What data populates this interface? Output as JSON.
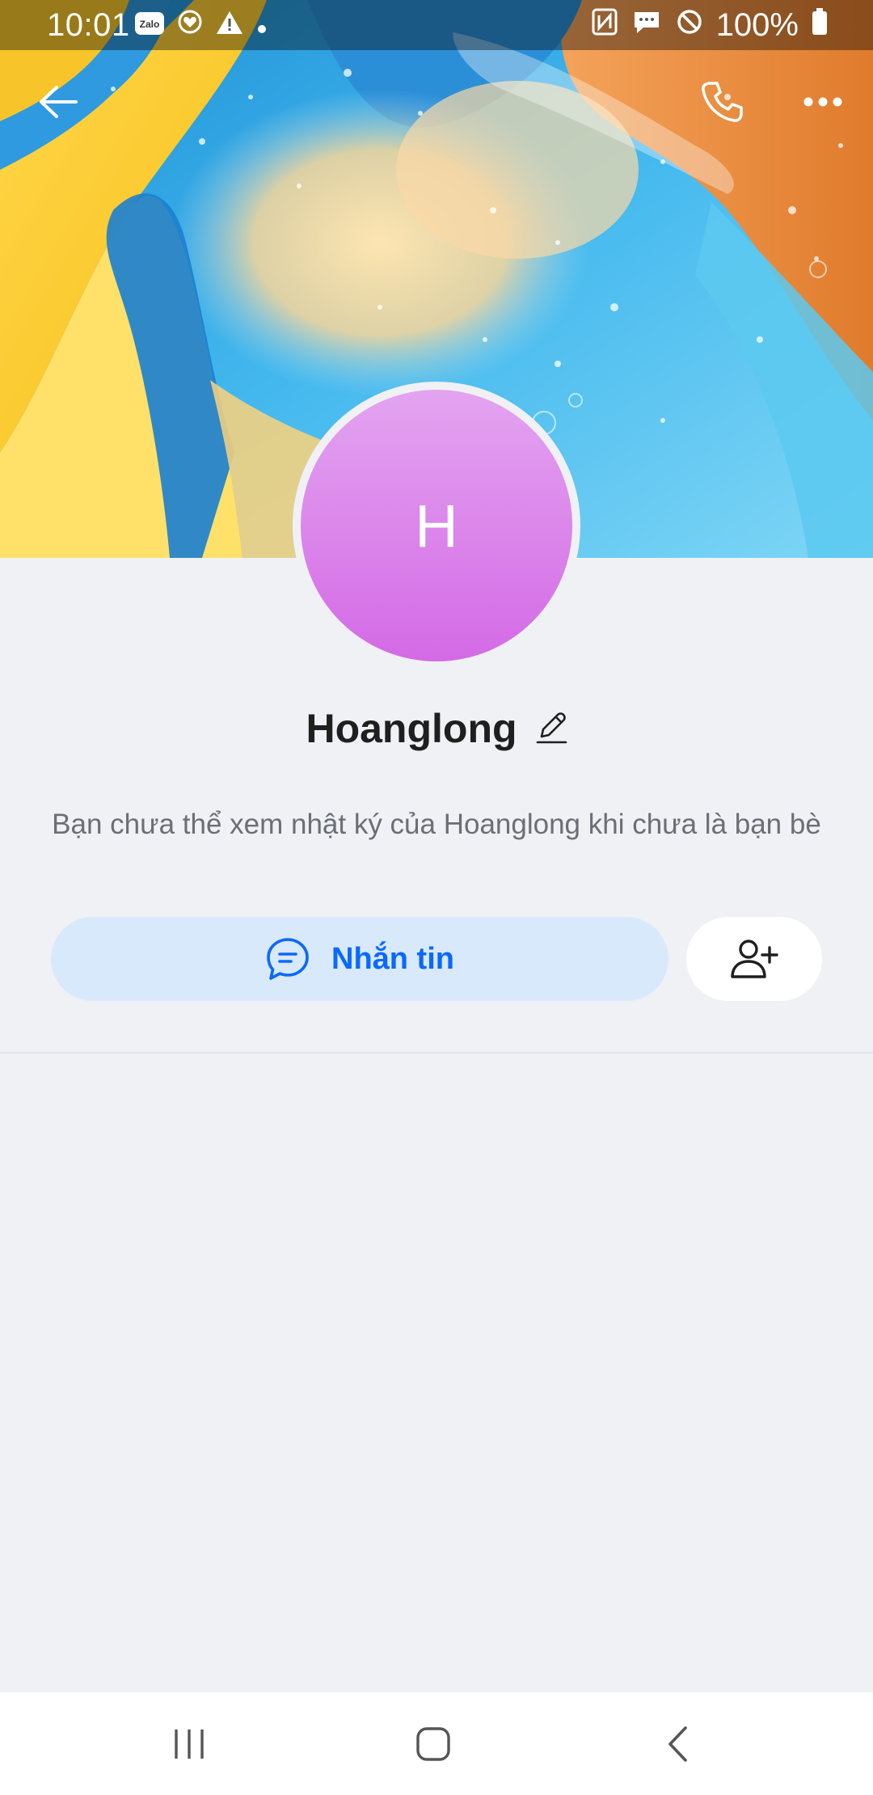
{
  "status_bar": {
    "time": "10:01",
    "battery": "100%",
    "left_icons": [
      "zalo-icon",
      "heart-sync-icon",
      "warning-icon",
      "dot-icon"
    ],
    "right_icons": [
      "nfc-icon",
      "message-icon",
      "do-not-disturb-icon",
      "battery-icon"
    ]
  },
  "top_bar": {
    "icons": [
      "back-arrow-icon",
      "phone-icon",
      "more-icon"
    ]
  },
  "profile": {
    "avatar_initial": "H",
    "name": "Hoanglong",
    "avatar_gradient": [
      "#e3a4f0",
      "#d46ae6"
    ],
    "notice": "Bạn chưa thể xem nhật ký của Hoanglong khi chưa là bạn bè"
  },
  "actions": {
    "message_label": "Nhắn tin",
    "message_icon": "chat-bubble-icon",
    "add_friend_icon": "add-user-icon"
  },
  "nav_bar": {
    "icons": [
      "recent-apps-icon",
      "home-icon",
      "back-icon"
    ]
  },
  "colors": {
    "accent": "#0a68ff",
    "message_button_bg": "#d9e9fc",
    "page_bg": "#f0f1f5"
  }
}
